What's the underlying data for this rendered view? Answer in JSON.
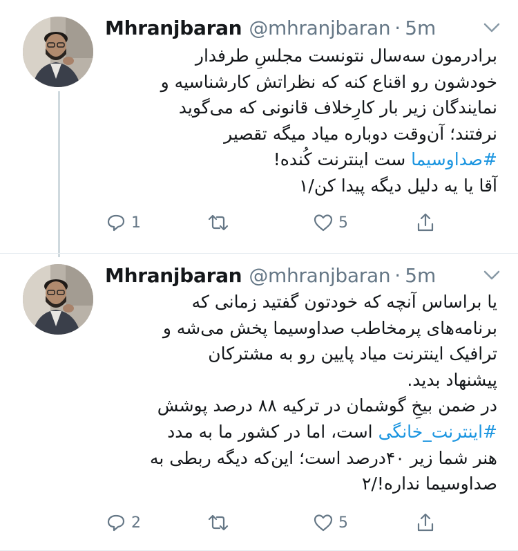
{
  "colors": {
    "accent": "#1b95e0",
    "text": "#14171a",
    "secondary": "#657786",
    "divider": "#e6ecf0"
  },
  "tweets": [
    {
      "author_name": "Mhranjbaran",
      "handle": "@mhranjbaran",
      "dot": "·",
      "time": "5m",
      "lines": [
        {
          "text": "برادرمون سه‌سال نتونست مجلسِ طرفدار"
        },
        {
          "text": "خودشون رو اقناع کنه که نظراتش کارشناسیه و"
        },
        {
          "text": "نمایندگان زیر بار کارِخلاف قانونی که می‌گوید"
        },
        {
          "text": "نرفتند؛ آن‌وقت دوباره میاد میگه تقصیر"
        },
        {
          "hashtag": "#صداوسیما",
          "text": " ست اینترنت کُنده!"
        },
        {
          "text": "آقا یا یه دلیل دیگه پیدا کن/۱"
        }
      ],
      "reply_count": "1",
      "retweet_count": "",
      "like_count": "5",
      "icons": [
        "reply-icon",
        "retweet-icon",
        "like-icon",
        "share-icon",
        "chevron-down-icon"
      ]
    },
    {
      "author_name": "Mhranjbaran",
      "handle": "@mhranjbaran",
      "dot": "·",
      "time": "5m",
      "lines": [
        {
          "text": "یا براساس آنچه که خودتون گفتید زمانی که"
        },
        {
          "text": "برنامه‌های پرمخاطب صداوسیما پخش می‌شه و"
        },
        {
          "text": "ترافیک اینترنت میاد پایین  رو به مشترکان"
        },
        {
          "text": "پیشنهاد بدید."
        },
        {
          "text": "در ضمن بیخِ گوشمان در ترکیه ۸۸ درصد پوشش"
        },
        {
          "hashtag": "#اینترنت_خانگی",
          "text": " است، اما در کشور ما به مدد"
        },
        {
          "text": "هنر شما زیر ۴۰درصد است؛ این‌که دیگه ربطی به"
        },
        {
          "text": "صداوسیما نداره!/۲"
        }
      ],
      "reply_count": "2",
      "retweet_count": "",
      "like_count": "5",
      "icons": [
        "reply-icon",
        "retweet-icon",
        "like-icon",
        "share-icon",
        "chevron-down-icon"
      ]
    }
  ]
}
